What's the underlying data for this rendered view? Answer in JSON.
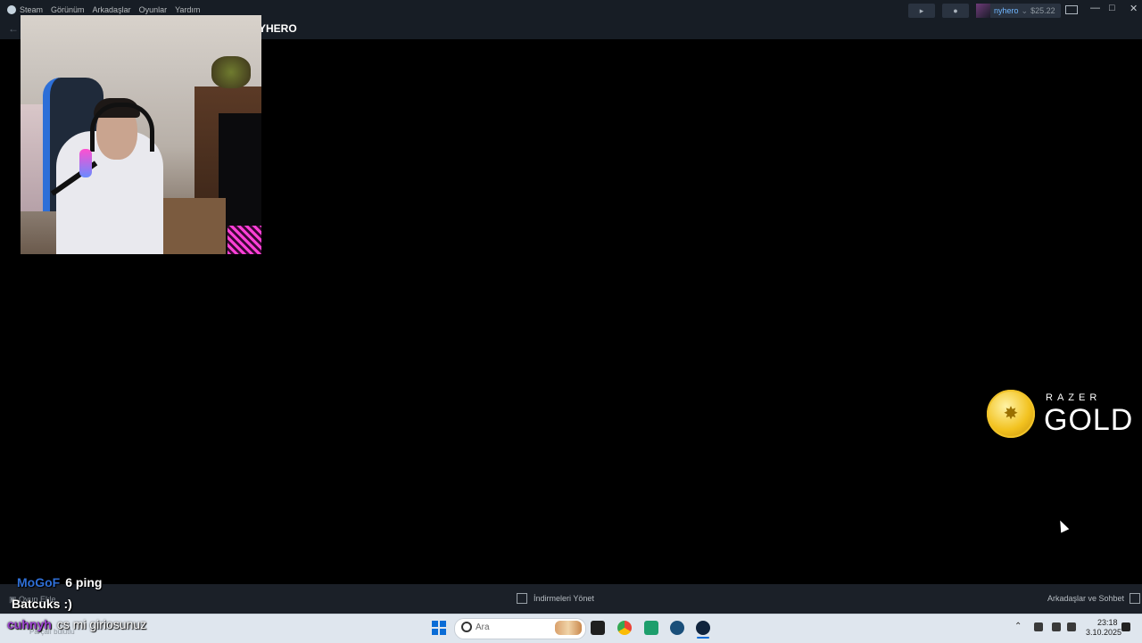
{
  "steam": {
    "menu": [
      "Steam",
      "Görünüm",
      "Arkadaşlar",
      "Oyunlar",
      "Yardım"
    ],
    "page_title_visible": "YHERO",
    "user": {
      "name": "nyhero",
      "caret": "⌄",
      "balance": "$25.22"
    },
    "bottom": {
      "add_game": "Oyun Ekle",
      "found_parts": "Parçalı bulutlu",
      "downloads": "İndirmeleri Yönet",
      "friends_chat": "Arkadaşlar ve Sohbet"
    }
  },
  "overlay": {
    "sponsor": {
      "word": "RAZER",
      "sub": "GOLD",
      "coin_color": "#f2c21f"
    },
    "chat": [
      {
        "user": "MoGoF",
        "message": "6 ping",
        "user_color": "#2f6fd6"
      },
      {
        "user": "Batcuks",
        "message": ":)",
        "user_color": "#ffffff"
      },
      {
        "user": "cuhnyh",
        "message": "cs mi giriosunuz",
        "user_color": "#9b3fcf"
      }
    ]
  },
  "taskbar": {
    "search_placeholder": "Ara",
    "time": "23:18",
    "date": "3.10.2025",
    "accent": "#0a6cd6"
  },
  "icons": {
    "announce": "megaphone-icon",
    "notify": "bell-icon",
    "start": "windows-start-icon",
    "chrome": "chrome-icon",
    "steam": "steam-icon"
  }
}
